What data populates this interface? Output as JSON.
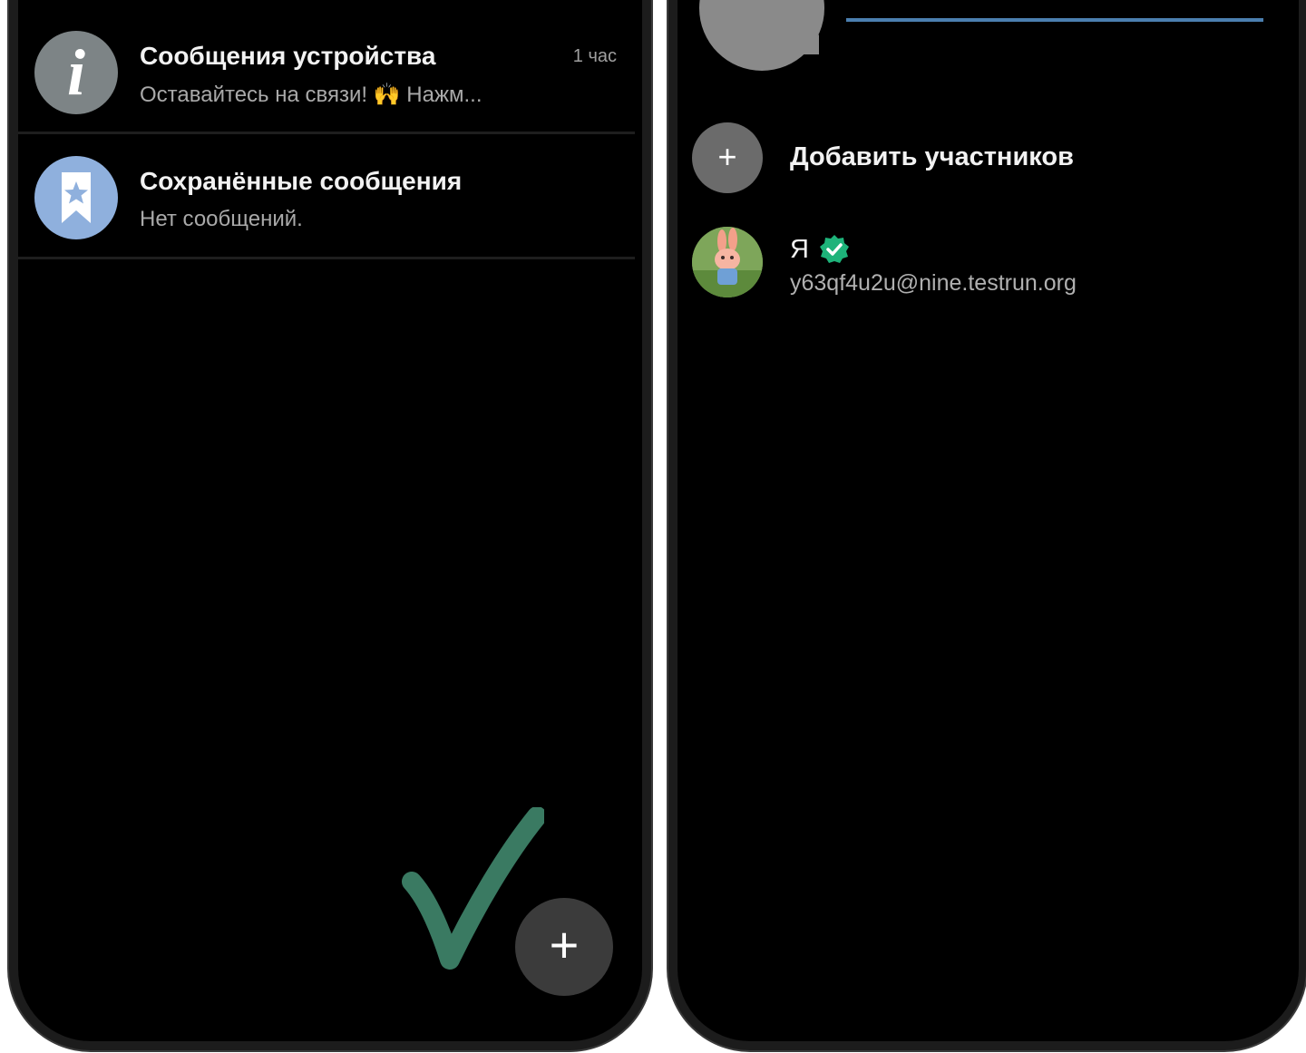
{
  "left_screen": {
    "chats": [
      {
        "title": "Сообщения устройства",
        "preview": "Оставайтесь на связи! 🙌 Нажм...",
        "time": "1 час",
        "avatar_icon": "info-icon",
        "avatar_glyph": "i",
        "avatar_color": "#7d8486"
      },
      {
        "title": "Сохранённые сообщения",
        "preview": "Нет сообщений.",
        "time": "",
        "avatar_icon": "bookmark-star-icon",
        "avatar_color": "#8fb0dd"
      }
    ],
    "fab": {
      "icon": "plus-icon",
      "glyph": "+"
    },
    "check_mark": {
      "icon": "checkmark-icon",
      "color": "#3a7a62"
    }
  },
  "right_screen": {
    "add_members": {
      "icon": "plus-icon",
      "glyph": "+",
      "label": "Добавить участников"
    },
    "member": {
      "name": "Я",
      "email": "y63qf4u2u@nine.testrun.org",
      "verified_icon": "verified-check-icon",
      "verified_color": "#1eb37a"
    },
    "accent_color": "#4b7fb0"
  }
}
